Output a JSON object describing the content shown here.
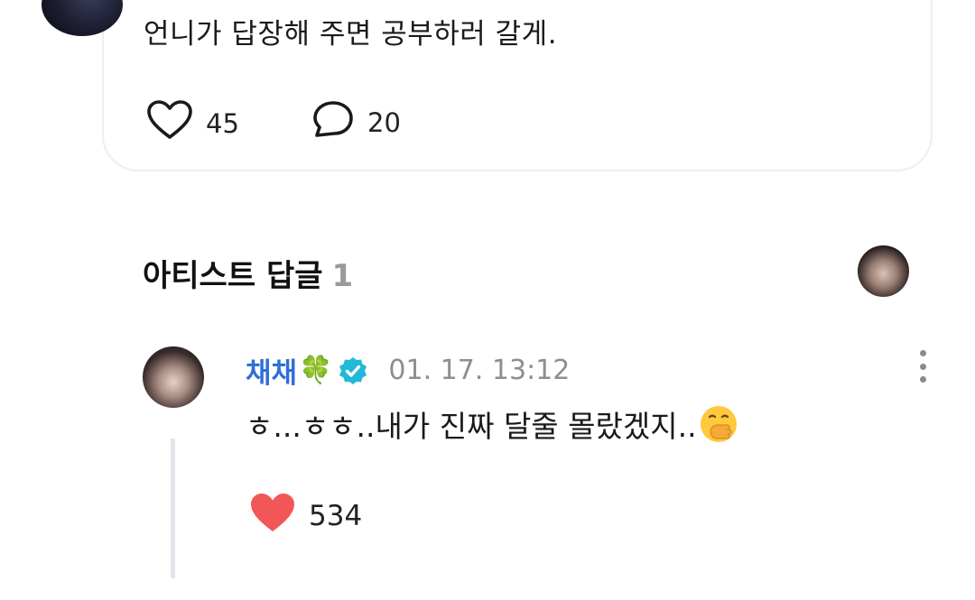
{
  "post": {
    "text": "언니가 답장해 주면 공부하러 갈게.",
    "like_count": "45",
    "comment_count": "20"
  },
  "artist_replies": {
    "title": "아티스트 답글",
    "count": "1"
  },
  "reply": {
    "author": "채채",
    "author_emoji": "🍀",
    "timestamp": "01. 17. 13:12",
    "text": "ㅎ...ㅎㅎ..내가 진짜 달줄 몰랐겠지..",
    "like_count": "534"
  },
  "colors": {
    "author_name": "#2f6fd6",
    "verified_badge": "#22b8d8",
    "liked_heart": "#f25757",
    "thread_line": "#e3e5ea"
  },
  "icons": {
    "post_like": "heart-outline-icon",
    "post_comment": "speech-bubble-icon",
    "verified": "verified-badge-icon",
    "more": "more-vertical-icon",
    "reply_like": "heart-filled-icon",
    "reply_emoji": "hand-over-mouth-emoji"
  }
}
